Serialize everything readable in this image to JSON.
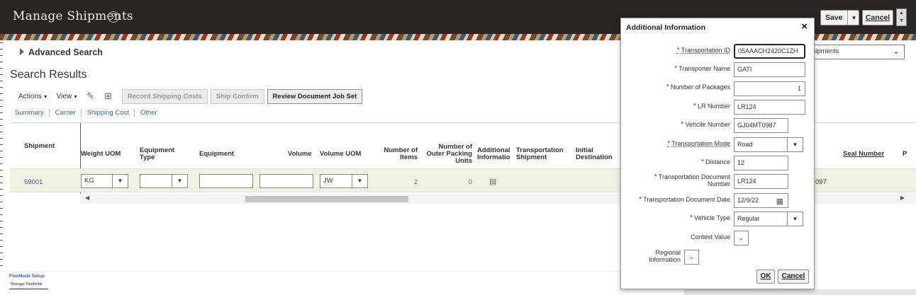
{
  "header": {
    "title": "Manage Shipments",
    "help_icon": "?",
    "save_label": "Save",
    "cancel_label": "Cancel"
  },
  "search": {
    "advanced_label": "Advanced Search",
    "results_title": "Search Results"
  },
  "toolbar": {
    "actions_label": "Actions",
    "view_label": "View",
    "buttons": [
      "Record Shipping Costs",
      "Ship Confirm",
      "Review Document Job Set"
    ]
  },
  "subtabs": [
    "Summary",
    "Carrier",
    "Shipping Cost",
    "Other"
  ],
  "table": {
    "headers": {
      "shipment": "Shipment",
      "weight_uom": "Weight UOM",
      "equipment_type": "Equipment Type",
      "equipment": "Equipment",
      "volume": "Volume",
      "volume_uom": "Volume UOM",
      "number_of_items": "Number of Items",
      "outer_packing_units": "Number of Outer Packing Units",
      "additional_info": "Additional Informatio",
      "transportation_shipment": "Transportation Shipment",
      "initial_destination": "Initial Destination",
      "seal_number": "Seal Number",
      "more": "P"
    },
    "row": {
      "shipment": "59001",
      "weight_uom": "KG",
      "volume_uom": "JW",
      "number_of_items": "2",
      "outer_packing_units": "0",
      "partial_value": "097"
    }
  },
  "background_select": {
    "value": "hipments"
  },
  "footer": {
    "app_name": "FlexMode Setup",
    "sub_label": "Manage Flexfields"
  },
  "dialog": {
    "title": "Additional Information",
    "fields": {
      "transportation_id": {
        "label": "Transportation ID",
        "value": "05AAACH2420C1ZH"
      },
      "transporter_name": {
        "label": "Transporter Name",
        "value": "GATI"
      },
      "number_of_packages": {
        "label": "Number of Packages",
        "value": "1"
      },
      "lr_number": {
        "label": "LR Number",
        "value": "LR124"
      },
      "vehicle_number": {
        "label": "Vehcile Number",
        "value": "GJ04MT0987"
      },
      "transportation_mode": {
        "label": "Transportation Mode",
        "value": "Road"
      },
      "distance": {
        "label": "Distance",
        "value": "12"
      },
      "transportation_document_number": {
        "label": "Transportation Document Number",
        "value": "LR124"
      },
      "transportation_document_date": {
        "label": "Transportation Document Date",
        "value": "12/9/22"
      },
      "vehicle_type": {
        "label": "Vehicle Type",
        "value": "Regular"
      },
      "context_value": {
        "label": "Context Value"
      },
      "regional_information": {
        "label": "Regional Information"
      }
    },
    "ok_label": "OK",
    "cancel_label": "Cancel"
  }
}
